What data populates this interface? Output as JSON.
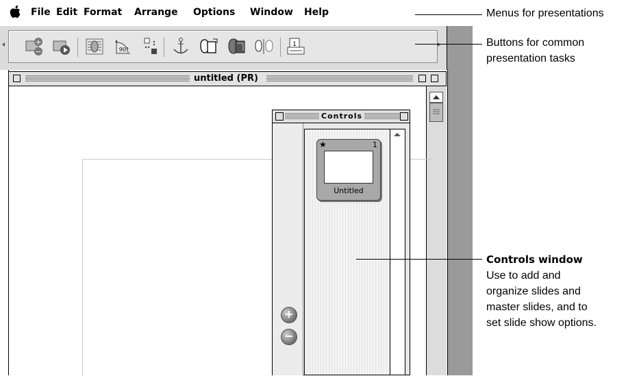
{
  "menu": {
    "apple_glyph": "",
    "items": [
      "File",
      "Edit",
      "Format",
      "Arrange",
      "Options",
      "Window",
      "Help"
    ]
  },
  "toolbar": {
    "buttons": [
      {
        "name": "add-slide-icon"
      },
      {
        "name": "play-slideshow-icon"
      },
      {
        "name": "text-wrap-icon"
      },
      {
        "name": "rotate-90-icon"
      },
      {
        "name": "align-objects-icon"
      },
      {
        "name": "anchor-icon"
      },
      {
        "name": "group-icon"
      },
      {
        "name": "ungroup-icon"
      },
      {
        "name": "spacing-icon"
      },
      {
        "name": "page-number-icon"
      }
    ]
  },
  "document": {
    "title": "untitled (PR)"
  },
  "controls": {
    "title": "Controls",
    "slide": {
      "number": "1",
      "label": "Untitled"
    },
    "add_glyph": "+",
    "remove_glyph": "−"
  },
  "callouts": {
    "menus": "Menus for presentations",
    "buttons_line1": "Buttons for common",
    "buttons_line2": "presentation tasks",
    "controls_title": "Controls window",
    "controls_line1": "Use to add and",
    "controls_line2": "organize slides and",
    "controls_line3": "master slides, and to",
    "controls_line4": "set slide show options."
  },
  "colors": {
    "chrome": "#dcdcdc",
    "desktop": "#9a9a9a"
  }
}
